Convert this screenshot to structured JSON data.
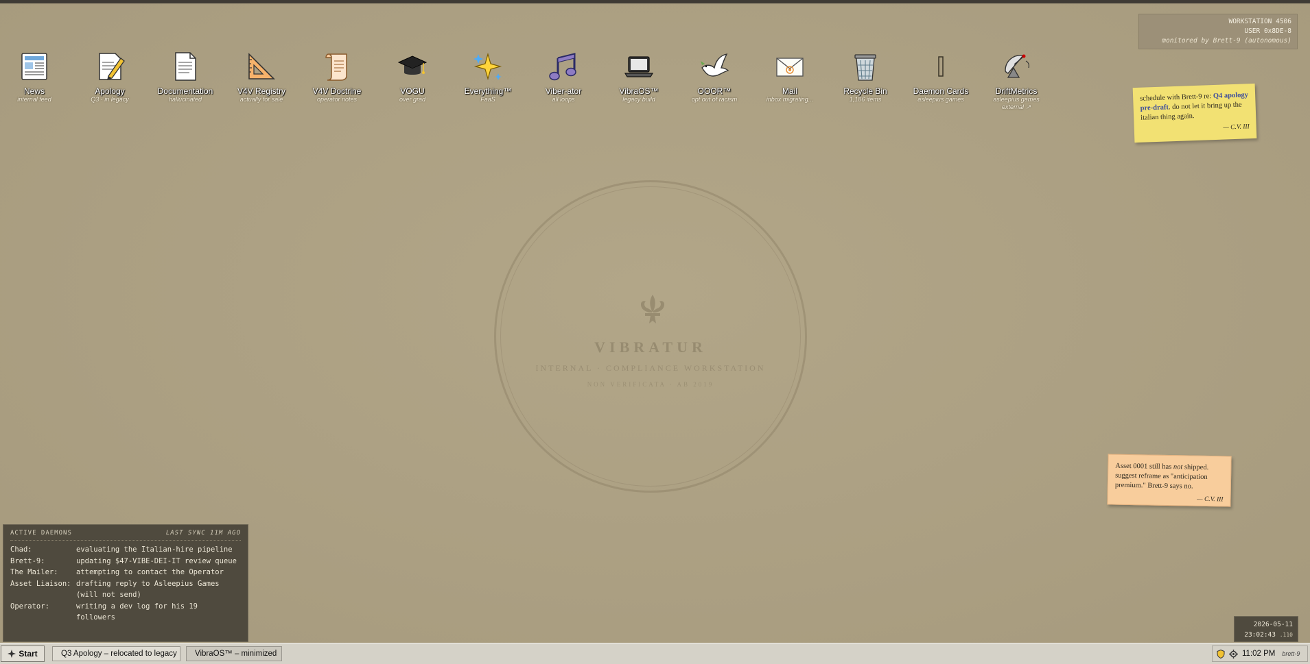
{
  "workstation": {
    "line1": "WORKSTATION 4506",
    "line2": "USER 0x8DE-8",
    "line3": "monitored by Brett-9 (autonomous)"
  },
  "icons": [
    {
      "label": "News",
      "sub": "internal feed",
      "icon": "newspaper-icon"
    },
    {
      "label": "Apology",
      "sub": "Q3 · in legacy",
      "icon": "document-pencil-icon"
    },
    {
      "label": "Documentation",
      "sub": "hallucinated",
      "icon": "document-icon"
    },
    {
      "label": "V4V Registry",
      "sub": "actually for sale",
      "icon": "set-square-icon"
    },
    {
      "label": "V4V Doctrine",
      "sub": "operator notes",
      "icon": "scroll-icon"
    },
    {
      "label": "VOGU",
      "sub": "over grad",
      "icon": "graduation-cap-icon"
    },
    {
      "label": "Everything™",
      "sub": "FaaS",
      "icon": "sparkles-icon"
    },
    {
      "label": "Viber-ator",
      "sub": "all loops",
      "icon": "music-note-icon"
    },
    {
      "label": "VibraOS™",
      "sub": "legacy build",
      "icon": "laptop-icon"
    },
    {
      "label": "OOOR™",
      "sub": "opt out of racism",
      "icon": "dove-icon"
    },
    {
      "label": "Mail",
      "sub": "inbox migrating...",
      "icon": "envelope-icon"
    },
    {
      "label": "Recycle Bin",
      "sub": "1,186 items",
      "icon": "trash-icon"
    },
    {
      "label": "Daemon Cards",
      "sub": "asleepius games",
      "icon": "card-icon"
    },
    {
      "label": "DriftMetrics",
      "sub": "asleepius games",
      "sub2": "external ↗",
      "icon": "satellite-dish-icon"
    }
  ],
  "notes": {
    "note1": {
      "prefix": "schedule with Brett-9 re: ",
      "highlight": "Q4 apology pre-draft",
      "suffix": ". do not let it bring up the italian thing again.",
      "signature": "— C.V. III"
    },
    "note2": {
      "part1": "Asset 0001 still has ",
      "em": "not",
      "part2": " shipped. suggest reframe as \"anticipation premium.\" Brett-9 says no.",
      "signature": "— C.V. III"
    }
  },
  "seal": {
    "title": "VIBRATUR",
    "subtitle": "INTERNAL · COMPLIANCE WORKSTATION",
    "motto": "NON VERIFICATA · AB 2019"
  },
  "daemons": {
    "title": "ACTIVE DAEMONS",
    "sync": "LAST SYNC 11M AGO",
    "rows": [
      {
        "who": "Chad:",
        "what": "evaluating the Italian-hire pipeline"
      },
      {
        "who": "Brett-9:",
        "what": "updating $47-VIBE-DEI-IT review queue"
      },
      {
        "who": "The Mailer:",
        "what": "attempting to contact the Operator"
      },
      {
        "who": "Asset Liaison:",
        "what": "drafting reply to Asleepius Games (will not send)"
      },
      {
        "who": "Operator:",
        "what": "writing a dev log for his 19 followers"
      }
    ]
  },
  "clock_widget": {
    "date": "2026-05-11",
    "time": "23:02:43",
    "ms": ".110"
  },
  "taskbar": {
    "start_label": "Start",
    "buttons": [
      {
        "label": "Q3 Apology – relocated to legacy"
      },
      {
        "label": "VibraOS™ – minimized"
      }
    ],
    "tray_time": "11:02 PM",
    "tray_user": "brett-9"
  },
  "colors": {
    "desktop": "#ada083",
    "note_yellow": "#f2e173",
    "note_peach": "#f8cd9c",
    "panel": "#4f4a3e",
    "taskbar": "#d5d2c8"
  }
}
